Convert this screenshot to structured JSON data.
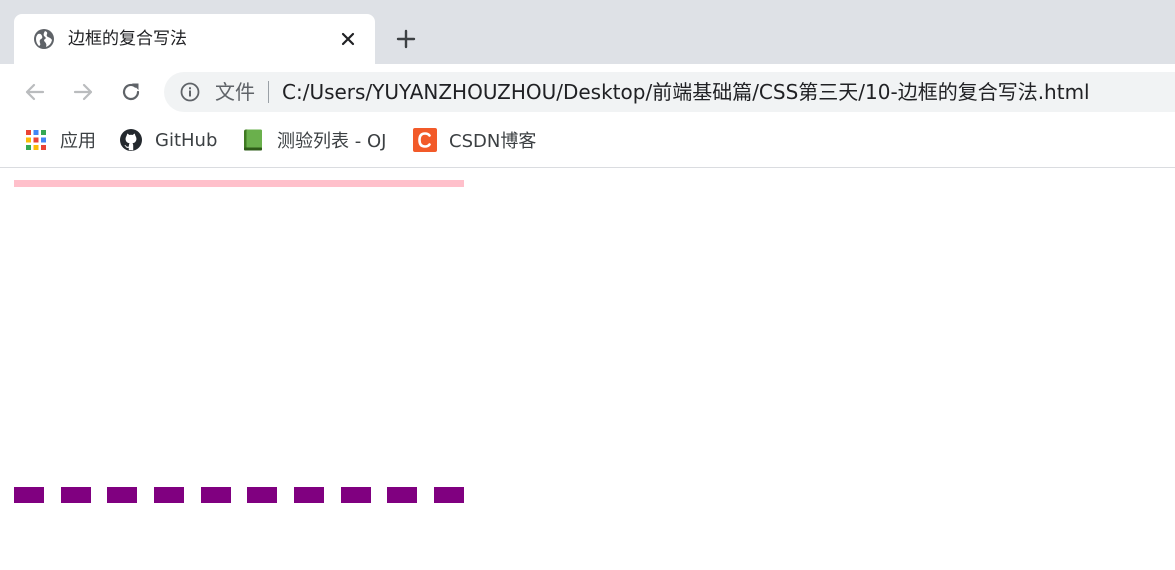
{
  "tab": {
    "title": "边框的复合写法",
    "favicon": "globe-icon"
  },
  "toolbar": {
    "scheme_label": "文件",
    "url": "C:/Users/YUYANZHOUZHOU/Desktop/前端基础篇/CSS第三天/10-边框的复合写法.html"
  },
  "bookmarks": [
    {
      "label": "应用",
      "icon": "apps-grid-icon"
    },
    {
      "label": "GitHub",
      "icon": "github-icon"
    },
    {
      "label": "测验列表 - OJ",
      "icon": "green-book-icon"
    },
    {
      "label": "CSDN博客",
      "icon": "csdn-icon"
    }
  ],
  "colors": {
    "box1_border": "#ffc0cb",
    "box2_border": "#800080",
    "csdn": "#f25a29",
    "book": "#5fa33a"
  }
}
